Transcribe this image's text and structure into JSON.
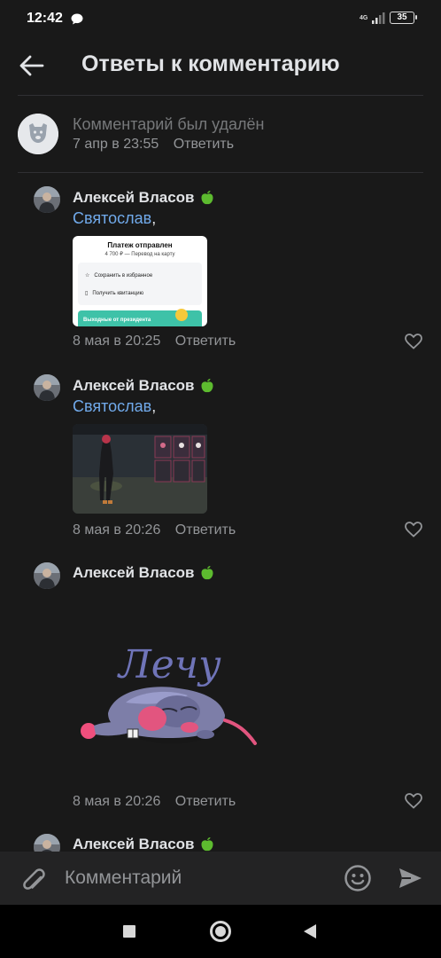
{
  "status_bar": {
    "time": "12:42",
    "network": "4G",
    "battery": "35"
  },
  "header": {
    "title": "Ответы к комментарию"
  },
  "parent_comment": {
    "text": "Комментарий был удалён",
    "date": "7 апр в 23:55",
    "reply_label": "Ответить"
  },
  "comments": [
    {
      "author": "Алексей Власов",
      "mention": "Святослав",
      "date": "8 мая в 20:25",
      "reply_label": "Ответить",
      "attachment": {
        "title": "Платеж отправлен",
        "subtitle": "4 700 ₽ — Перевод на карту",
        "row1": "Сохранить в избранное",
        "row2": "Получить квитанцию",
        "banner": "Выходные от президента"
      }
    },
    {
      "author": "Алексей Власов",
      "mention": "Святослав",
      "date": "8 мая в 20:26",
      "reply_label": "Ответить"
    },
    {
      "author": "Алексей Власов",
      "date": "8 мая в 20:26",
      "reply_label": "Ответить",
      "sticker_text": "Лечу"
    },
    {
      "author": "Алексей Власов"
    }
  ],
  "input": {
    "placeholder": "Комментарий"
  },
  "icons": [
    "arrow-left-icon",
    "apple-icon",
    "heart-icon",
    "paperclip-icon",
    "smile-icon",
    "send-icon"
  ],
  "colors": {
    "background": "#191919",
    "link": "#71aaeb",
    "secondary": "#939598",
    "apple": "#5dbb2f"
  }
}
